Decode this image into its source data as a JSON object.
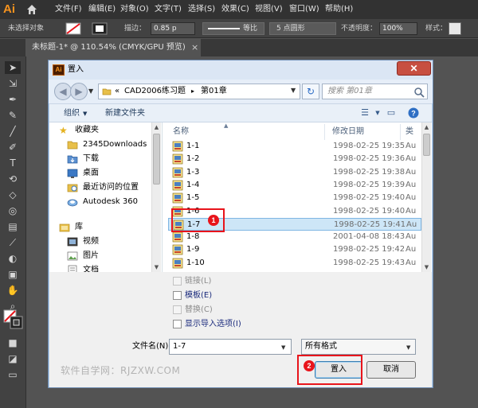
{
  "app": {
    "logo": "Ai",
    "menu": [
      "文件(F)",
      "编辑(E)",
      "对象(O)",
      "文字(T)",
      "选择(S)",
      "效果(C)",
      "视图(V)",
      "窗口(W)",
      "帮助(H)"
    ]
  },
  "control_bar": {
    "selection_label": "未选择对象",
    "stroke_label": "描边：",
    "stroke_value": "0.85 p",
    "stroke_profile": "等比",
    "brush": "5 点圆形",
    "opacity_label": "不透明度：",
    "opacity_value": "100%",
    "style_label": "样式："
  },
  "document_tab": {
    "title": "未标题-1* @ 110.54% (CMYK/GPU 预览)",
    "close": "×"
  },
  "dialog": {
    "title": "置入",
    "close": "✕",
    "address": {
      "prefix": "«",
      "segment_1": "CAD2006练习题",
      "separator": "▸",
      "segment_2": "第01章"
    },
    "search_placeholder": "搜索 第01章",
    "commands": {
      "organize": "组织",
      "new_folder": "新建文件夹"
    },
    "nav": {
      "favorites_header": "收藏夹",
      "favorites": [
        "2345Downloads",
        "下载",
        "桌面",
        "最近访问的位置",
        "Autodesk 360"
      ],
      "library_header": "库",
      "libraries": [
        "视频",
        "图片",
        "文档"
      ]
    },
    "columns": {
      "name": "名称",
      "date": "修改日期",
      "type": "类"
    },
    "files": [
      {
        "name": "1-1",
        "date": "1998-02-25 19:35",
        "type": "Au"
      },
      {
        "name": "1-2",
        "date": "1998-02-25 19:36",
        "type": "Au"
      },
      {
        "name": "1-3",
        "date": "1998-02-25 19:38",
        "type": "Au"
      },
      {
        "name": "1-4",
        "date": "1998-02-25 19:39",
        "type": "Au"
      },
      {
        "name": "1-5",
        "date": "1998-02-25 19:40",
        "type": "Au"
      },
      {
        "name": "1-6",
        "date": "1998-02-25 19:40",
        "type": "Au"
      },
      {
        "name": "1-7",
        "date": "1998-02-25 19:41",
        "type": "Au"
      },
      {
        "name": "1-8",
        "date": "2001-04-08 18:43",
        "type": "Au"
      },
      {
        "name": "1-9",
        "date": "1998-02-25 19:42",
        "type": "Au"
      },
      {
        "name": "1-10",
        "date": "1998-02-25 19:43",
        "type": "Au"
      }
    ],
    "selected_file": "1-7",
    "options": {
      "link": "链接(L)",
      "template": "模板(E)",
      "replace": "替换(C)",
      "show_import": "显示导入选项(I)"
    },
    "filename_label": "文件名(N):",
    "filename_value": "1-7",
    "filetype_value": "所有格式",
    "place_button": "置入",
    "cancel_button": "取消",
    "watermark": "软件自学网：RJZXW.COM"
  },
  "callouts": {
    "step1": "1",
    "step2": "2"
  },
  "colors": {
    "accent_red": "#e8141b",
    "ai_orange": "#f7931e",
    "selection_blue": "#cde6f7"
  }
}
